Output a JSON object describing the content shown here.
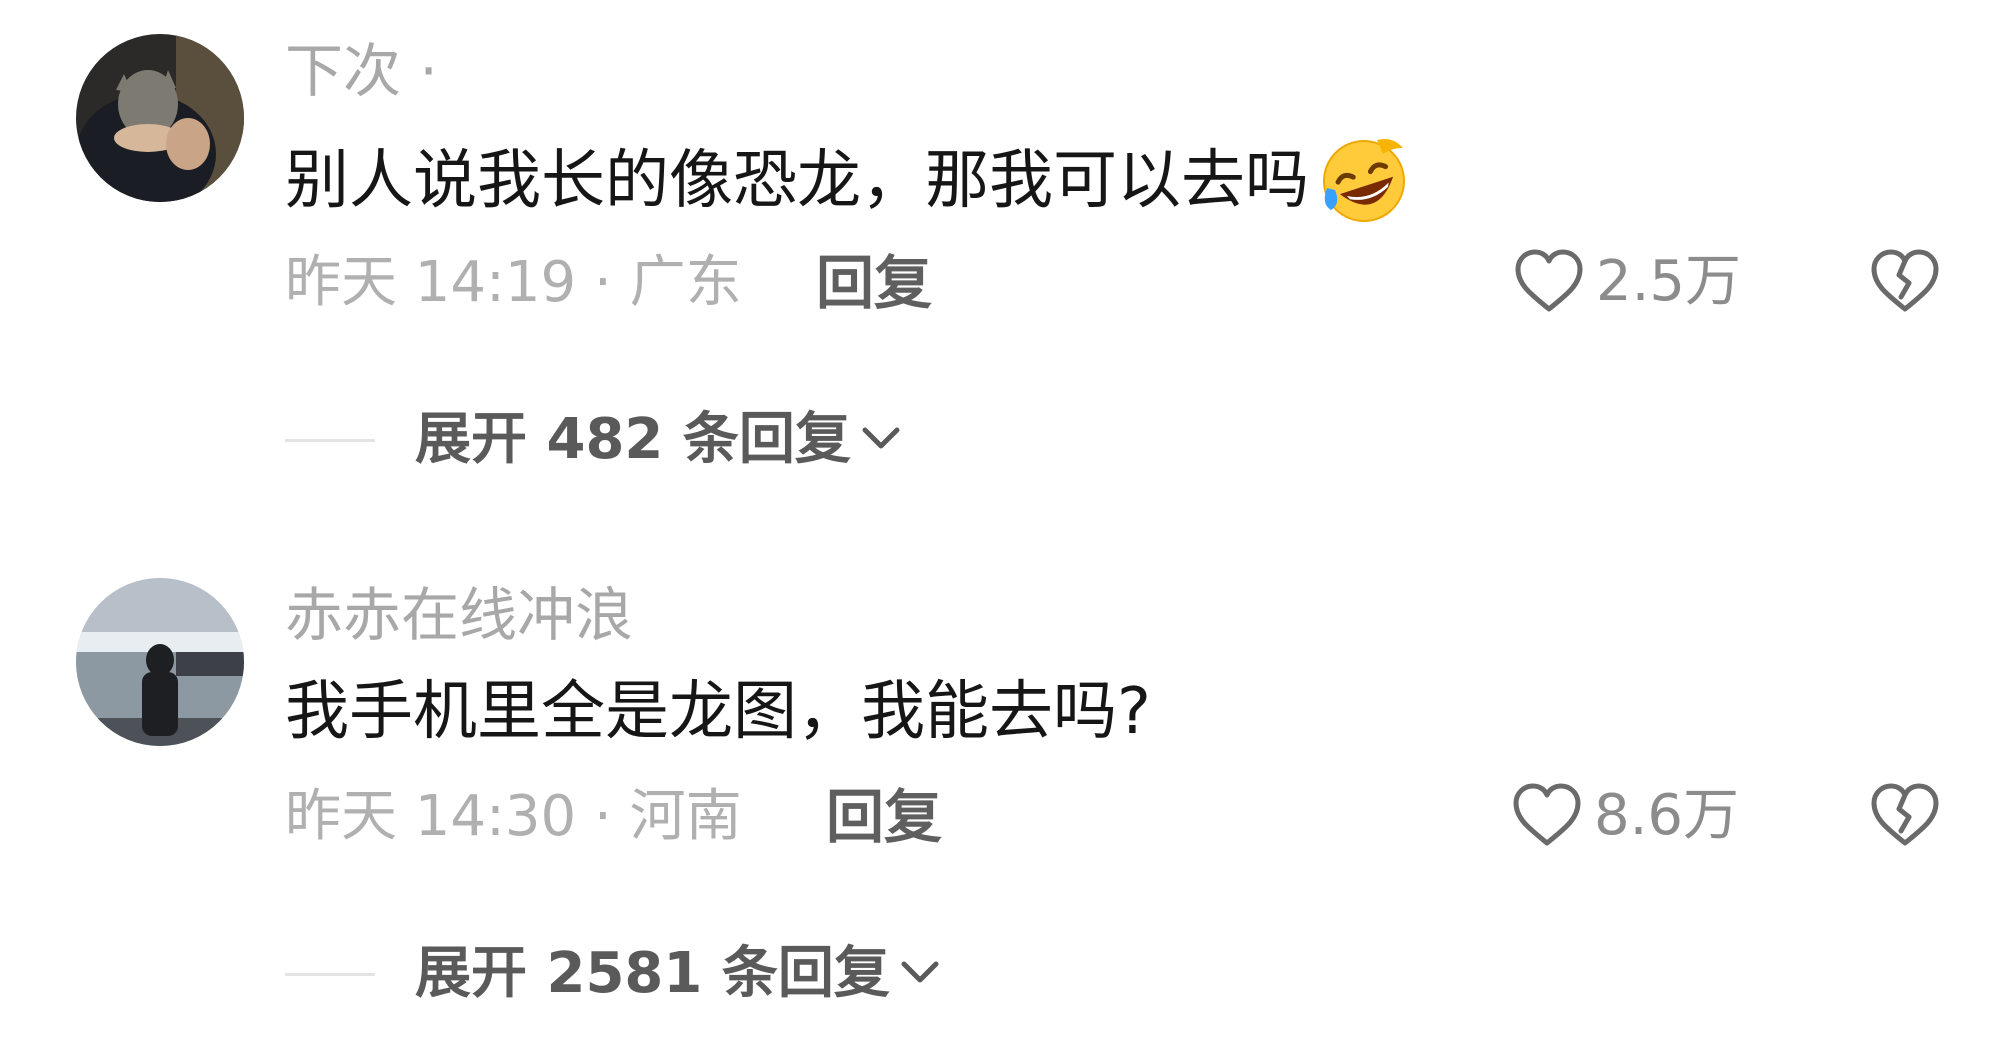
{
  "comments": [
    {
      "username": "下次 ·",
      "text": "别人说我长的像恐龙，那我可以去吗",
      "emoji": "rofl-emoji",
      "time_location": "昨天 14:19 · 广东",
      "reply_label": "回复",
      "likes": "2.5万",
      "expand_label": "展开 482 条回复"
    },
    {
      "username": "赤赤在线冲浪",
      "text": "我手机里全是龙图，我能去吗?",
      "time_location": "昨天 14:30 · 河南",
      "reply_label": "回复",
      "likes": "8.6万",
      "expand_label": "展开 2581 条回复"
    }
  ],
  "colors": {
    "username": "#a8a8a8",
    "text": "#161616",
    "meta": "#b0b0b0",
    "reply": "#5f5f5f",
    "icon": "#6a6a6a"
  }
}
